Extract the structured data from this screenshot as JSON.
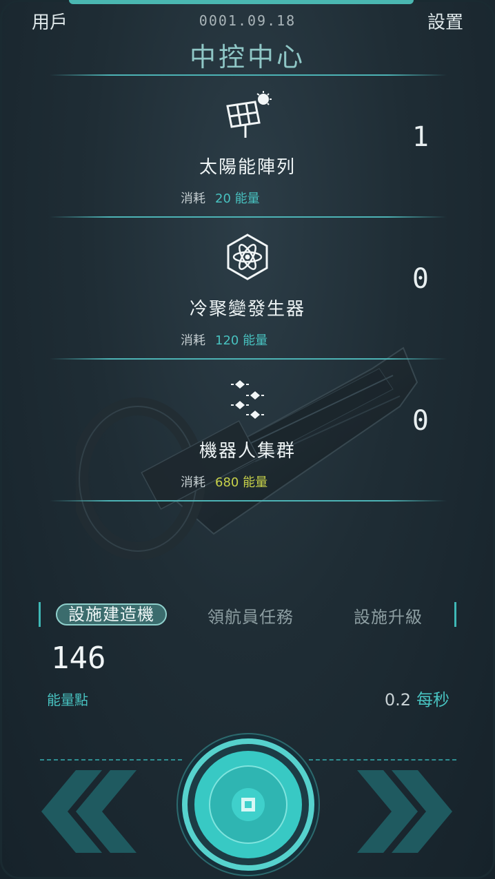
{
  "header": {
    "user_label": "用戶",
    "date": "0001.09.18",
    "settings_label": "設置",
    "title": "中控中心"
  },
  "facilities": [
    {
      "name": "太陽能陣列",
      "cost_label": "消耗",
      "cost_value": "20 能量",
      "count": "1",
      "icon": "solar-panel-icon",
      "cost_color": "#48c2c0"
    },
    {
      "name": "冷聚變發生器",
      "cost_label": "消耗",
      "cost_value": "120 能量",
      "count": "0",
      "icon": "atom-icon",
      "cost_color": "#48c2c0"
    },
    {
      "name": "機器人集群",
      "cost_label": "消耗",
      "cost_value": "680 能量",
      "count": "0",
      "icon": "robot-swarm-icon",
      "cost_color": "#c8d24a"
    }
  ],
  "tabs": [
    {
      "label": "設施建造機",
      "active": true
    },
    {
      "label": "領航員任務",
      "active": false
    },
    {
      "label": "設施升級",
      "active": false
    }
  ],
  "energy": {
    "value": "146",
    "label": "能量點",
    "rate_value": "0.2",
    "rate_unit": "每秒"
  },
  "colors": {
    "accent": "#48c2c0",
    "background": "#1f2d35",
    "highlight_cost": "#c8d24a"
  }
}
